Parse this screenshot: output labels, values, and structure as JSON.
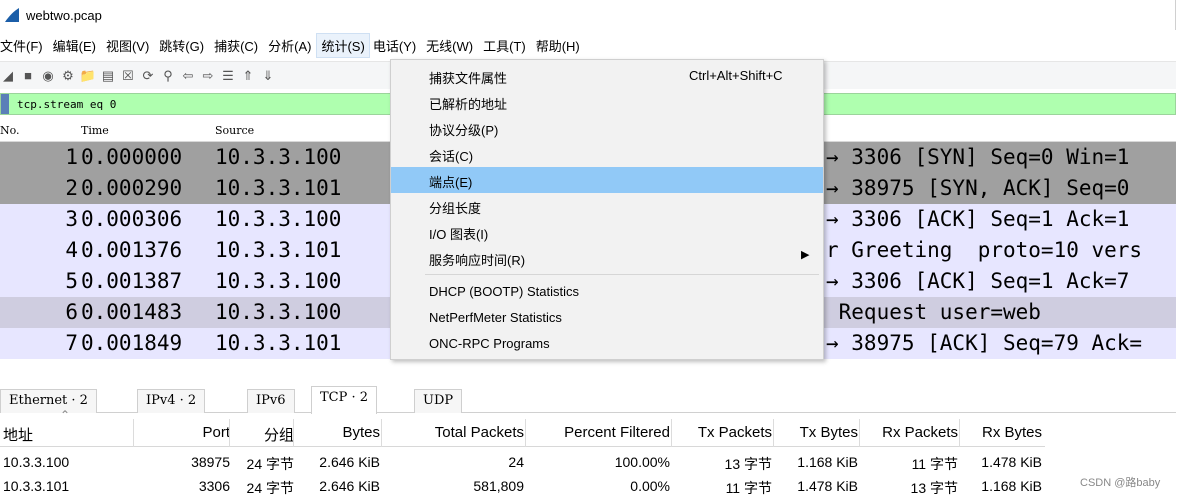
{
  "window": {
    "title": "webtwo.pcap"
  },
  "menubar": [
    "文件(F)",
    "编辑(E)",
    "视图(V)",
    "跳转(G)",
    "捕获(C)",
    "分析(A)",
    "统计(S)",
    "电话(Y)",
    "无线(W)",
    "工具(T)",
    "帮助(H)"
  ],
  "toolbar": [
    "start-capture-icon",
    "stop-capture-icon",
    "restart-capture-icon",
    "capture-options-icon",
    "open-file-icon",
    "save-file-icon",
    "close-file-icon",
    "reload-file-icon",
    "find-packet-icon",
    "go-back-icon",
    "go-forward-icon",
    "go-to-packet-icon",
    "first-packet-icon",
    "last-packet-icon"
  ],
  "filter": {
    "value": "tcp.stream eq 0"
  },
  "packet_list": {
    "headers": {
      "no": "No.",
      "time": "Time",
      "source": "Source"
    },
    "rows": [
      {
        "no": "1",
        "time": "0.000000",
        "source": "10.3.3.100",
        "info": "→ 3306 [SYN] Seq=0 Win=1",
        "bg": "#a0a0a0"
      },
      {
        "no": "2",
        "time": "0.000290",
        "source": "10.3.3.101",
        "info": "→ 38975 [SYN, ACK] Seq=0",
        "bg": "#a0a0a0"
      },
      {
        "no": "3",
        "time": "0.000306",
        "source": "10.3.3.100",
        "info": "→ 3306 [ACK] Seq=1 Ack=1",
        "bg": "#e7e6ff"
      },
      {
        "no": "4",
        "time": "0.001376",
        "source": "10.3.3.101",
        "info": "r Greeting  proto=10 vers",
        "bg": "#e7e6ff"
      },
      {
        "no": "5",
        "time": "0.001387",
        "source": "10.3.3.100",
        "info": "→ 3306 [ACK] Seq=1 Ack=7",
        "bg": "#e7e6ff"
      },
      {
        "no": "6",
        "time": "0.001483",
        "source": "10.3.3.100",
        "info": " Request user=web",
        "bg": "#cfcde0"
      },
      {
        "no": "7",
        "time": "0.001849",
        "source": "10.3.3.101",
        "info": "→ 38975 [ACK] Seq=79 Ack=",
        "bg": "#e7e6ff"
      }
    ]
  },
  "stats_menu": {
    "items": [
      {
        "label": "捕获文件属性",
        "shortcut": "Ctrl+Alt+Shift+C"
      },
      {
        "label": "已解析的地址"
      },
      {
        "label": "协议分级(P)"
      },
      {
        "label": "会话(C)"
      },
      {
        "label": "端点(E)",
        "highlighted": true
      },
      {
        "label": "分组长度"
      },
      {
        "label": "I/O 图表(I)"
      },
      {
        "label": "服务响应时间(R)",
        "submenu": true
      },
      {
        "label": "DHCP (BOOTP) Statistics"
      },
      {
        "label": "NetPerfMeter Statistics"
      },
      {
        "label": "ONC-RPC Programs"
      }
    ]
  },
  "endpoint_tabs": [
    "Ethernet · 2",
    "IPv4 · 2",
    "IPv6",
    "TCP · 2",
    "UDP"
  ],
  "endpoint_active_tab": 3,
  "endpoints": {
    "headers": [
      "地址",
      "Port",
      "分组",
      "Bytes",
      "Total Packets",
      "Percent Filtered",
      "Tx Packets",
      "Tx Bytes",
      "Rx Packets",
      "Rx Bytes"
    ],
    "rows": [
      [
        "10.3.3.100",
        "38975",
        "24 字节",
        "2.646 KiB",
        "24",
        "100.00%",
        "13 字节",
        "1.168 KiB",
        "11 字节",
        "1.478 KiB"
      ],
      [
        "10.3.3.101",
        "3306",
        "24 字节",
        "2.646 KiB",
        "581,809",
        "0.00%",
        "11 字节",
        "1.478 KiB",
        "13 字节",
        "1.168 KiB"
      ]
    ]
  },
  "watermark": "CSDN @路baby"
}
